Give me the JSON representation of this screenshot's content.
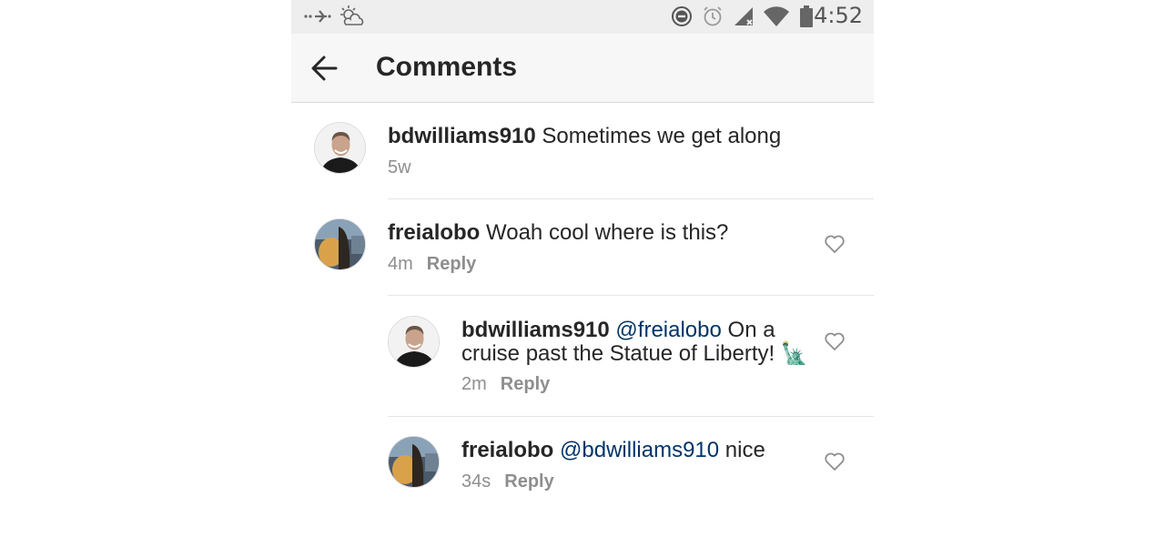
{
  "status_bar": {
    "time": "4:52",
    "icons": [
      "airplane-dotted-icon",
      "weather-icon",
      "do-not-disturb-icon",
      "alarm-icon",
      "signal-icon",
      "wifi-icon",
      "battery-icon"
    ]
  },
  "header": {
    "title": "Comments",
    "back_icon": "back-arrow-icon"
  },
  "comments": [
    {
      "username": "bdwilliams910",
      "mention": "",
      "text": "Sometimes we get along",
      "time": "5w",
      "reply_label": "",
      "avatar": "user-avatar-bdwilliams910"
    },
    {
      "username": "freialobo",
      "mention": "",
      "text": "Woah cool where is this?",
      "time": "4m",
      "reply_label": "Reply",
      "avatar": "user-avatar-freialobo"
    },
    {
      "username": "bdwilliams910",
      "mention": "@freialobo",
      "text": "On a cruise past the Statue of Liberty! 🗽",
      "time": "2m",
      "reply_label": "Reply",
      "avatar": "user-avatar-bdwilliams910"
    },
    {
      "username": "freialobo",
      "mention": "@bdwilliams910",
      "text": "nice",
      "time": "34s",
      "reply_label": "Reply",
      "avatar": "user-avatar-freialobo"
    }
  ],
  "colors": {
    "mention": "#003569",
    "meta": "#8e8e8e",
    "header_bg": "#f7f7f7",
    "status_bg": "#eeeeee"
  }
}
